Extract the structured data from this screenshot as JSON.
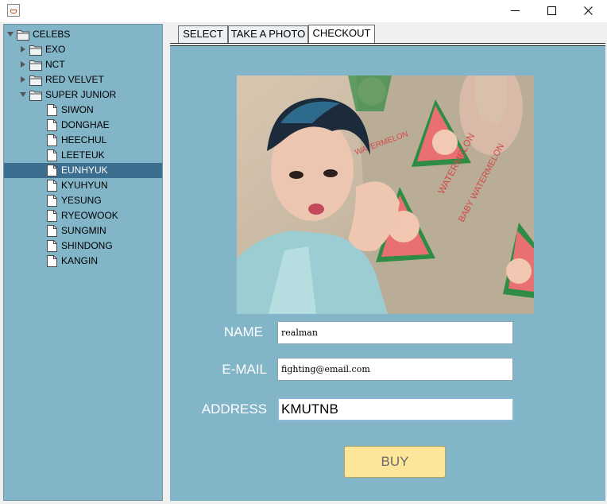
{
  "window": {
    "icon": "java-cup-icon",
    "controls": [
      "minimize-icon",
      "maximize-icon",
      "close-icon"
    ]
  },
  "tree": {
    "root": "CELEBS",
    "groups": [
      {
        "label": "EXO",
        "expanded": false
      },
      {
        "label": "NCT",
        "expanded": false
      },
      {
        "label": "RED VELVET",
        "expanded": false
      },
      {
        "label": "SUPER JUNIOR",
        "expanded": true
      }
    ],
    "members": [
      "SIWON",
      "DONGHAE",
      "HEECHUL",
      "LEETEUK",
      "EUNHYUK",
      "KYUHYUN",
      "YESUNG",
      "RYEOWOOK",
      "SUNGMIN",
      "SHINDONG",
      "KANGIN"
    ],
    "selected": "EUNHYUK"
  },
  "tabs": [
    {
      "label": "SELECT"
    },
    {
      "label": "TAKE A PHOTO"
    },
    {
      "label": "CHECKOUT",
      "active": true
    }
  ],
  "form": {
    "name_label": "NAME",
    "name_value": "realman",
    "email_label": "E-MAIL",
    "email_value": "fighting@email.com",
    "address_label": "ADDRESS",
    "address_value": "KMUTNB",
    "buy_label": "BUY"
  },
  "photo": {
    "sticker_text_1": "WATERMELON",
    "sticker_text_2": "BABY WATERMELON",
    "sticker_text_3": "WATERMELON"
  },
  "colors": {
    "panel": "#83b5c8",
    "selection": "#3c6e8f",
    "buy_button": "#fde59a"
  }
}
